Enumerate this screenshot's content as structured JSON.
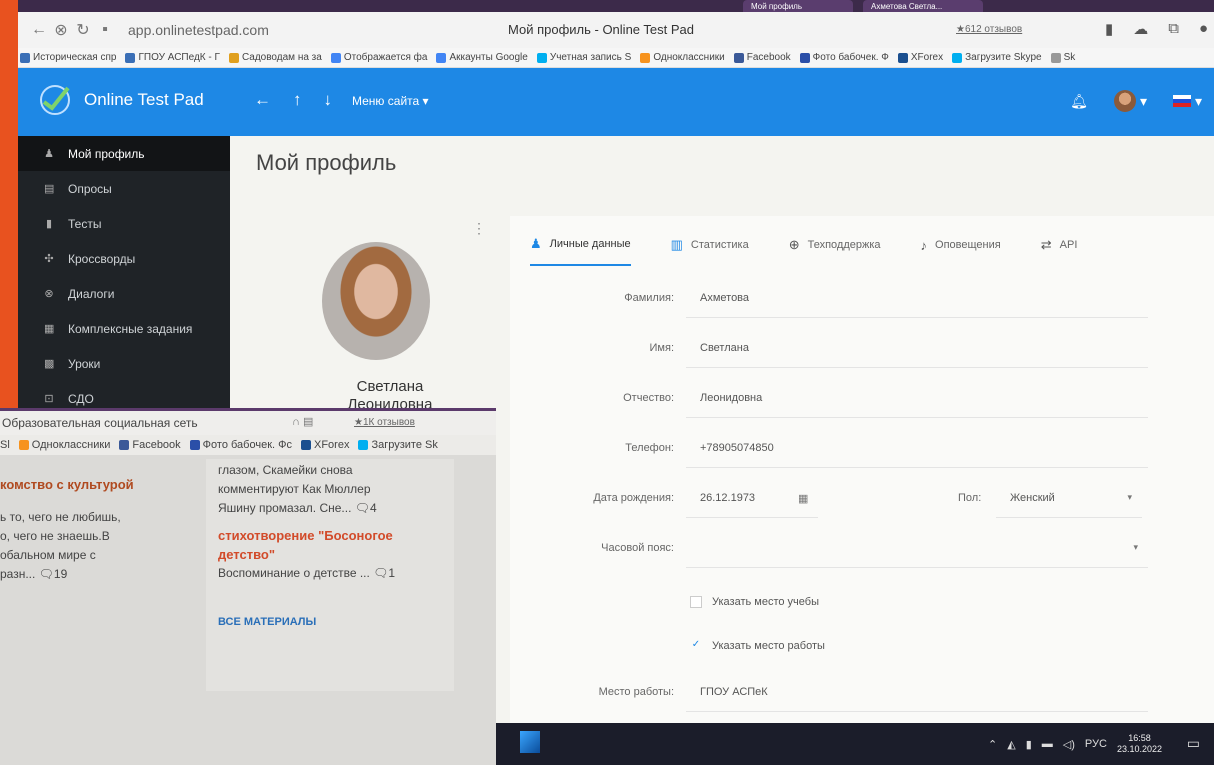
{
  "browser": {
    "url": "app.onlinetestpad.com",
    "page_title": "Мой профиль - Online Test Pad",
    "reviews": "★612 отзывов",
    "tabs": [
      "Мой профиль",
      "Ахметова Светла..."
    ],
    "bookmarks": [
      "Историческая спр",
      "ГПОУ АСПедК - Г",
      "Садоводам на за",
      "Отображается фа",
      "Аккаунты Google",
      "Учетная запись S",
      "Одноклассники",
      "Facebook",
      "Фото бабочек. Ф",
      "XForex",
      "Загрузите Skype",
      "Sk"
    ]
  },
  "app": {
    "brand": "Online Test Pad",
    "site_menu": "Меню сайта",
    "colors": {
      "accent": "#1e88e5",
      "sidebar": "#1f2327",
      "frame": "#e8521f"
    }
  },
  "sidebar": {
    "items": [
      {
        "label": "Мой профиль",
        "icon": "user-icon"
      },
      {
        "label": "Опросы",
        "icon": "poll-icon"
      },
      {
        "label": "Тесты",
        "icon": "test-icon"
      },
      {
        "label": "Кроссворды",
        "icon": "crossword-icon"
      },
      {
        "label": "Диалоги",
        "icon": "dialog-icon"
      },
      {
        "label": "Комплексные задания",
        "icon": "tasks-icon"
      },
      {
        "label": "Уроки",
        "icon": "lessons-icon"
      },
      {
        "label": "СДО",
        "icon": "lms-icon"
      }
    ]
  },
  "main": {
    "page_title": "Мой профиль",
    "profile": {
      "first_name": "Светлана",
      "middle_name": "Леонидовна"
    },
    "tabs": [
      {
        "label": "Личные данные",
        "icon": "person-icon"
      },
      {
        "label": "Статистика",
        "icon": "stats-icon"
      },
      {
        "label": "Техподдержка",
        "icon": "support-icon"
      },
      {
        "label": "Оповещения",
        "icon": "bell-icon"
      },
      {
        "label": "API",
        "icon": "api-icon"
      }
    ],
    "form": {
      "surname": {
        "label": "Фамилия:",
        "value": "Ахметова"
      },
      "name": {
        "label": "Имя:",
        "value": "Светлана"
      },
      "patronymic": {
        "label": "Отчество:",
        "value": "Леонидовна"
      },
      "phone": {
        "label": "Телефон:",
        "value": "+78905074850"
      },
      "birthdate": {
        "label": "Дата рождения:",
        "value": "26.12.1973"
      },
      "sex": {
        "label": "Пол:",
        "value": "Женский"
      },
      "timezone": {
        "label": "Часовой пояс:",
        "value": ""
      },
      "study_place": {
        "label": "Указать место учебы",
        "checked": false
      },
      "work_place_toggle": {
        "label": "Указать место работы",
        "checked": true
      },
      "workplace": {
        "label": "Место работы:",
        "value": "ГПОУ АСПеК"
      }
    }
  },
  "taskbar": {
    "lang": "РУС",
    "time": "16:58",
    "date": "23.10.2022"
  },
  "inset": {
    "title": "Образовательная социальная сеть",
    "reviews": "★1К отзывов",
    "bookmarks": [
      "Sl",
      "Одноклассники",
      "Facebook",
      "Фото бабочек. Фс",
      "XForex",
      "Загрузите Sk"
    ],
    "left_heading": "комство с культурой",
    "left_text": [
      "ь то, чего не любишь,",
      "о, чего не знаешь.В",
      "обальном мире с",
      "разн... 🗨19"
    ],
    "right_text": [
      "глазом, Скамейки снова",
      "комментируют Как Мюллер",
      "Яшину промазал. Сне... 🗨4"
    ],
    "right_link": "стихотворение \"Босоногое детство\"",
    "right_snippet": "Воспоминание о детстве ... 🗨1",
    "all_materials": "ВСЕ МАТЕРИАЛЫ"
  }
}
